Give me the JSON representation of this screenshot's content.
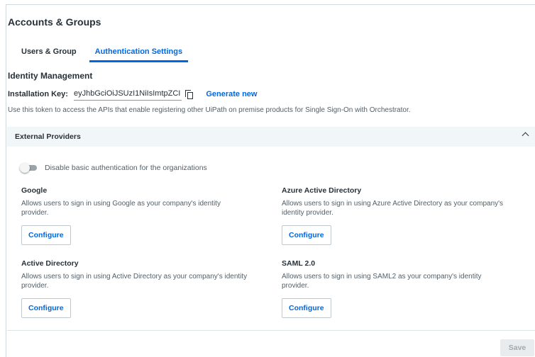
{
  "page": {
    "title": "Accounts & Groups"
  },
  "tabs": [
    {
      "label": "Users & Group",
      "active": false
    },
    {
      "label": "Authentication Settings",
      "active": true
    }
  ],
  "identity": {
    "title": "Identity Management",
    "installation_key_label": "Installation Key:",
    "installation_key_value": "eyJhbGciOiJSUzI1NiIsImtpZCI",
    "generate_label": "Generate new",
    "help_text": "Use this token to access the APIs that enable registering other UiPath on premise products for Single Sign-On with Orchestrator."
  },
  "external_providers": {
    "title": "External Providers",
    "expanded": true,
    "toggle_label": "Disable basic authentication for the organizations",
    "toggle_on": false,
    "providers": [
      {
        "title": "Google",
        "description": "Allows users to sign in using Google as your company's identity provider.",
        "button_label": "Configure"
      },
      {
        "title": "Azure Active Directory",
        "description": "Allows users to sign in using Azure Active Directory as your company's identity provider.",
        "button_label": "Configure"
      },
      {
        "title": "Active Directory",
        "description": "Allows users to sign in using Active Directory as your company's identity provider.",
        "button_label": "Configure"
      },
      {
        "title": "SAML 2.0",
        "description": "Allows users to sign in using SAML2 as your company's identity provider.",
        "button_label": "Configure"
      }
    ]
  },
  "footer": {
    "save_label": "Save",
    "save_enabled": false
  },
  "colors": {
    "accent": "#0067df",
    "header_bg": "#f1f6f8",
    "text": "#273139",
    "muted": "#526069"
  },
  "icons": {
    "copy": "copy-icon",
    "collapse": "chevron-up-icon"
  }
}
